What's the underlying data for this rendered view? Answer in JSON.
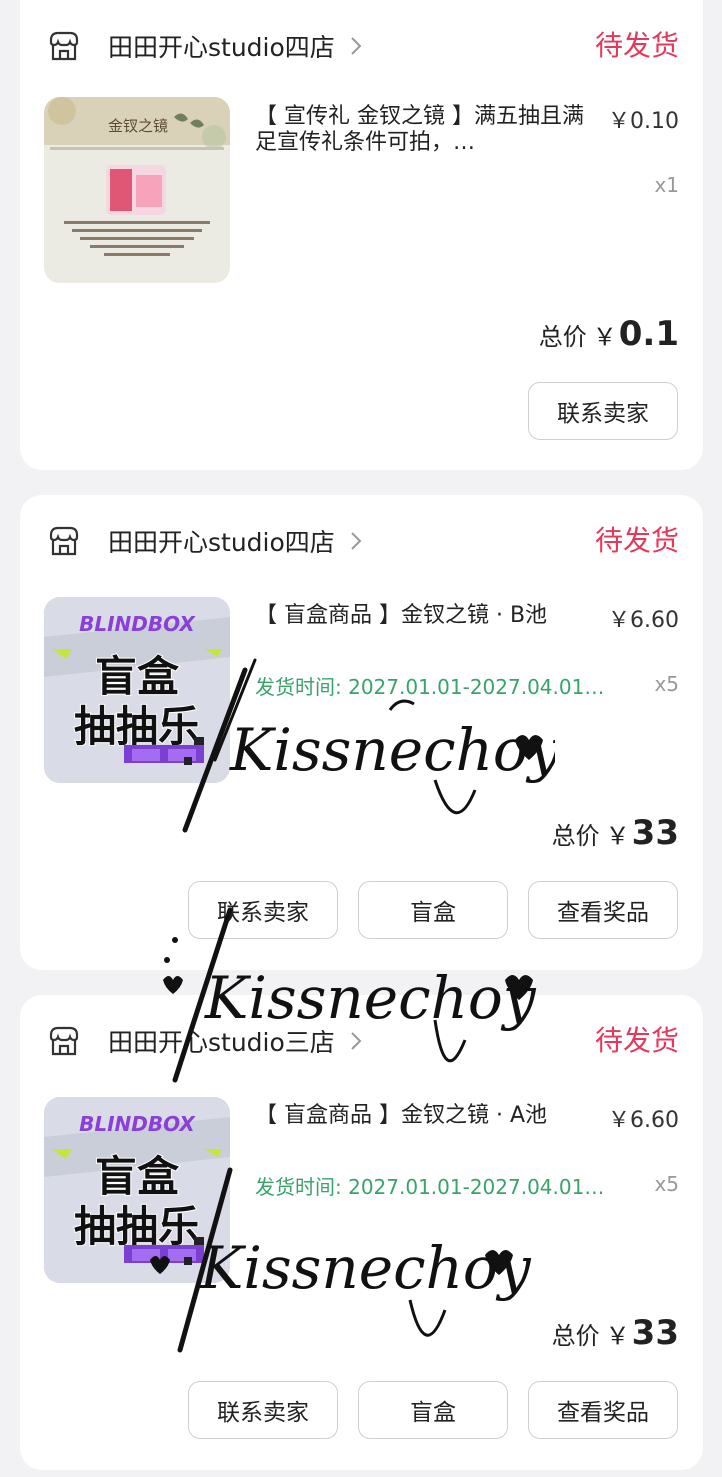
{
  "orders": [
    {
      "shop": "田田开心studio四店",
      "status": "待发货",
      "title": "【 宣传礼 金钗之镜 】满五抽且满足宣传礼条件可拍，…",
      "price": "￥0.10",
      "qty": "x1",
      "total_label": "总价",
      "total_currency": "￥",
      "total_amount": "0.1",
      "buttons": [
        "联系卖家"
      ]
    },
    {
      "shop": "田田开心studio四店",
      "status": "待发货",
      "title": "【 盲盒商品 】金钗之镜 · B池",
      "price": "￥6.60",
      "qty": "x5",
      "ship_time": "发货时间: 2027.01.01-2027.04.01…",
      "total_label": "总价",
      "total_currency": "￥",
      "total_amount": "33",
      "buttons": [
        "联系卖家",
        "盲盒",
        "查看奖品"
      ]
    },
    {
      "shop": "田田开心studio三店",
      "status": "待发货",
      "title": "【 盲盒商品 】金钗之镜 · A池",
      "price": "￥6.60",
      "qty": "x5",
      "ship_time": "发货时间: 2027.01.01-2027.04.01…",
      "total_label": "总价",
      "total_currency": "￥",
      "total_amount": "33",
      "buttons": [
        "联系卖家",
        "盲盒",
        "查看奖品"
      ]
    }
  ],
  "thumb": {
    "poster_title": "金钗之镜",
    "blindbox_brand": "BLINDBOX",
    "blindbox_text_1": "盲盒",
    "blindbox_text_2": "抽抽乐"
  },
  "watermark_text": "Kissnechoy",
  "colors": {
    "status": "#e5385b",
    "ship_time": "#3aa36a",
    "background": "#f2f2f4"
  }
}
